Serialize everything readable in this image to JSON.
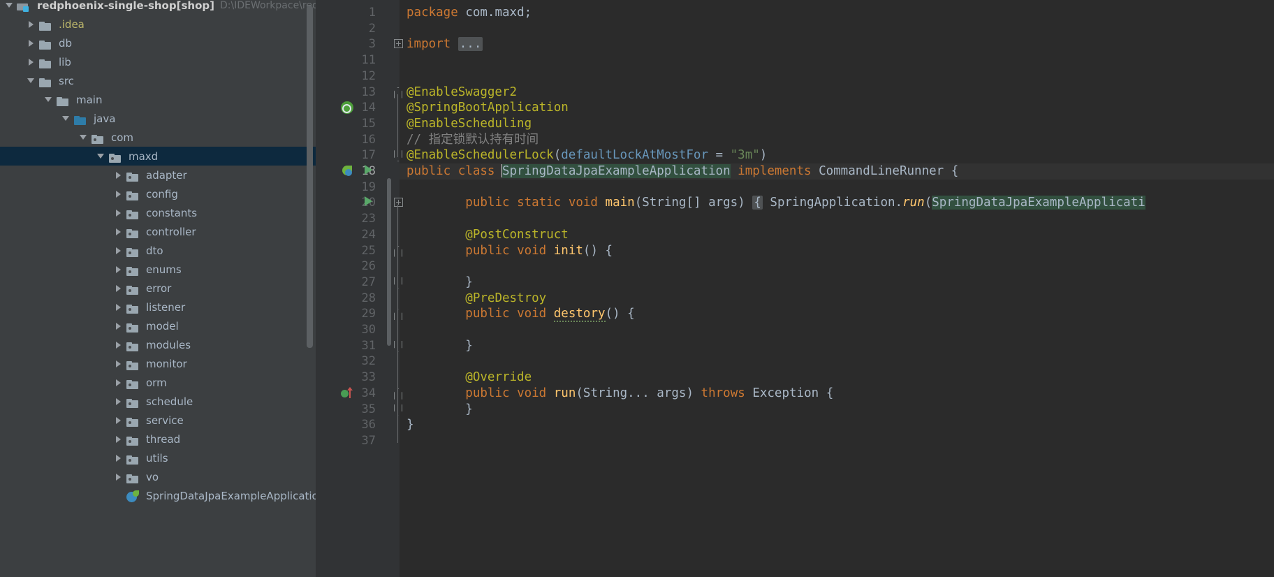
{
  "window": {
    "title": "redphoenix-single-shop",
    "theme": "darcula"
  },
  "top_progress": {
    "visible": true,
    "color": "#3592e0"
  },
  "project_tree": {
    "root": {
      "label": "redphoenix-single-shop",
      "module_tag": "[shop]",
      "path": "D:\\IDEWorkpace\\redp",
      "icon": "module-icon",
      "expanded": true
    },
    "items": [
      {
        "label": ".idea",
        "icon": "folder-icon",
        "depth": 1,
        "state": "collapsed",
        "color": "yellow"
      },
      {
        "label": "db",
        "icon": "folder-icon",
        "depth": 1,
        "state": "collapsed",
        "color": "normal"
      },
      {
        "label": "lib",
        "icon": "folder-icon",
        "depth": 1,
        "state": "collapsed",
        "color": "normal"
      },
      {
        "label": "src",
        "icon": "folder-icon",
        "depth": 1,
        "state": "expanded",
        "color": "normal"
      },
      {
        "label": "main",
        "icon": "folder-icon",
        "depth": 2,
        "state": "expanded",
        "color": "normal"
      },
      {
        "label": "java",
        "icon": "source-root-icon",
        "depth": 3,
        "state": "expanded",
        "color": "normal"
      },
      {
        "label": "com",
        "icon": "package-icon",
        "depth": 4,
        "state": "expanded",
        "color": "normal"
      },
      {
        "label": "maxd",
        "icon": "package-icon",
        "depth": 5,
        "state": "expanded",
        "color": "normal",
        "selected": true
      },
      {
        "label": "adapter",
        "icon": "package-icon",
        "depth": 6,
        "state": "collapsed",
        "color": "normal"
      },
      {
        "label": "config",
        "icon": "package-icon",
        "depth": 6,
        "state": "collapsed",
        "color": "normal"
      },
      {
        "label": "constants",
        "icon": "package-icon",
        "depth": 6,
        "state": "collapsed",
        "color": "normal"
      },
      {
        "label": "controller",
        "icon": "package-icon",
        "depth": 6,
        "state": "collapsed",
        "color": "normal"
      },
      {
        "label": "dto",
        "icon": "package-icon",
        "depth": 6,
        "state": "collapsed",
        "color": "normal"
      },
      {
        "label": "enums",
        "icon": "package-icon",
        "depth": 6,
        "state": "collapsed",
        "color": "normal"
      },
      {
        "label": "error",
        "icon": "package-icon",
        "depth": 6,
        "state": "collapsed",
        "color": "normal"
      },
      {
        "label": "listener",
        "icon": "package-icon",
        "depth": 6,
        "state": "collapsed",
        "color": "normal"
      },
      {
        "label": "model",
        "icon": "package-icon",
        "depth": 6,
        "state": "collapsed",
        "color": "normal"
      },
      {
        "label": "modules",
        "icon": "package-icon",
        "depth": 6,
        "state": "collapsed",
        "color": "normal"
      },
      {
        "label": "monitor",
        "icon": "package-icon",
        "depth": 6,
        "state": "collapsed",
        "color": "normal"
      },
      {
        "label": "orm",
        "icon": "package-icon",
        "depth": 6,
        "state": "collapsed",
        "color": "normal"
      },
      {
        "label": "schedule",
        "icon": "package-icon",
        "depth": 6,
        "state": "collapsed",
        "color": "normal"
      },
      {
        "label": "service",
        "icon": "package-icon",
        "depth": 6,
        "state": "collapsed",
        "color": "normal"
      },
      {
        "label": "thread",
        "icon": "package-icon",
        "depth": 6,
        "state": "collapsed",
        "color": "normal"
      },
      {
        "label": "utils",
        "icon": "package-icon",
        "depth": 6,
        "state": "collapsed",
        "color": "normal"
      },
      {
        "label": "vo",
        "icon": "package-icon",
        "depth": 6,
        "state": "collapsed",
        "color": "normal"
      },
      {
        "label": "SpringDataJpaExampleApplication",
        "icon": "spring-class-icon",
        "depth": 6,
        "state": "leaf",
        "color": "normal"
      }
    ]
  },
  "editor": {
    "file": "SpringDataJpaExampleApplication.java",
    "current_line": 18,
    "line_numbers": [
      1,
      2,
      3,
      11,
      12,
      13,
      14,
      15,
      16,
      17,
      18,
      19,
      20,
      23,
      24,
      25,
      26,
      27,
      28,
      29,
      30,
      31,
      32,
      33,
      34,
      35,
      36,
      37
    ],
    "lines": {
      "l1": "package com.maxd;",
      "l3": "import ...",
      "l13": "@EnableSwagger2",
      "l14": "@SpringBootApplication",
      "l15": "@EnableScheduling",
      "l16": "// 指定锁默认持有时间",
      "l17": "@EnableSchedulerLock(defaultLockAtMostFor = \"3m\")",
      "l18": "public class SpringDataJpaExampleApplication implements CommandLineRunner {",
      "l20": "    public static void main(String[] args) { SpringApplication.run(SpringDataJpaExampleApplicati",
      "l24": "    @PostConstruct",
      "l25": "    public void init() {",
      "l27": "    }",
      "l28": "    @PreDestroy",
      "l29": "    public void destory() {",
      "l31": "    }",
      "l33": "    @Override",
      "l34": "    public void run(String... args) throws Exception {",
      "l35": "    }",
      "l36": "}"
    },
    "tokens": {
      "kw_package": "package",
      "pkg_name": "com.maxd;",
      "kw_import": "import",
      "fold_placeholder": "...",
      "ann_swagger": "@EnableSwagger2",
      "ann_sba": "@SpringBootApplication",
      "ann_sched": "@EnableScheduling",
      "comment_cn": "// 指定锁默认持有时间",
      "ann_lock": "@EnableSchedulerLock",
      "attr_lock": "defaultLockAtMostFor",
      "eq": "=",
      "str_3m": "\"3m\"",
      "kw_public": "public",
      "kw_class": "class",
      "cls_main": "SpringDataJpaExampleApplication",
      "kw_implements": "implements",
      "iface": "CommandLineRunner",
      "kw_static": "static",
      "kw_void": "void",
      "mth_main": "main",
      "type_string_arr": "String[]",
      "arg_args": "args",
      "cls_springapp": "SpringApplication",
      "mth_run_static": "run",
      "ann_postconstruct": "@PostConstruct",
      "mth_init": "init",
      "ann_predestroy": "@PreDestroy",
      "mth_destory": "destory",
      "ann_override": "@Override",
      "mth_run": "run",
      "type_varargs": "String...",
      "kw_throws": "throws",
      "exc": "Exception"
    },
    "gutter_icons": {
      "line14": "spring-bean-icon",
      "line18_bean": "spring-boot-run-icon",
      "line18_run": "run-play-icon",
      "line20_run": "run-play-icon",
      "line34_override": "implementing-method-icon"
    },
    "colors": {
      "background": "#2b2b2b",
      "gutter": "#313335",
      "current_line": "#323232",
      "keyword": "#cc7832",
      "annotation": "#bbb529",
      "string": "#6a8759",
      "comment": "#808080",
      "number": "#6897bb",
      "method": "#ffc66d",
      "identifier": "#a9b7c6",
      "usage_highlight": "#32503f",
      "selection": "#0d293e"
    }
  }
}
